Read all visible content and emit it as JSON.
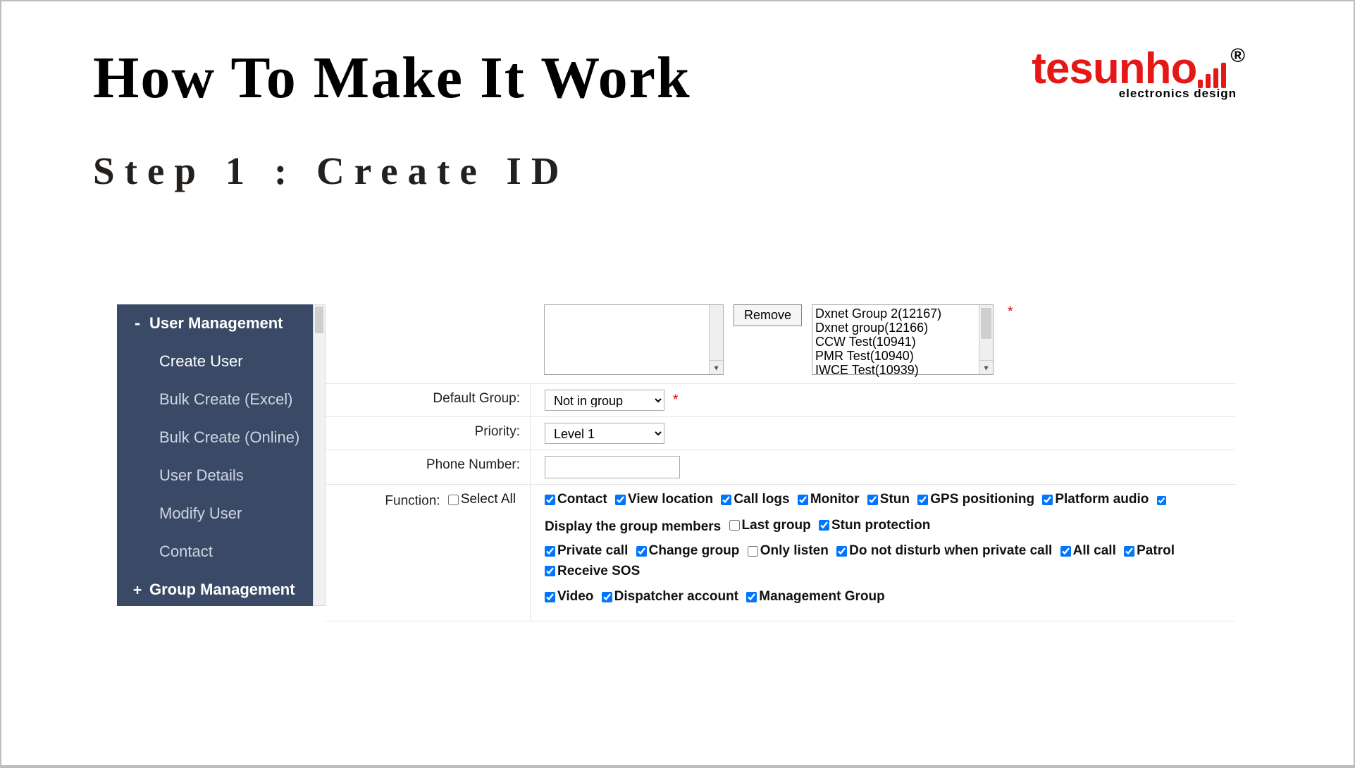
{
  "title": "How To Make It Work",
  "step": "Step 1 : Create ID",
  "logo": {
    "text": "tesunho",
    "sub": "electronics design",
    "reg": "®"
  },
  "sidebar": {
    "sections": [
      {
        "label": "User Management",
        "expanded": true,
        "toggle": "-",
        "items": [
          "Create User",
          "Bulk Create (Excel)",
          "Bulk Create (Online)",
          "User Details",
          "Modify User",
          "Contact"
        ]
      },
      {
        "label": "Group Management",
        "expanded": false,
        "toggle": "+"
      }
    ]
  },
  "form": {
    "remove_btn": "Remove",
    "group_list": [
      "Dxnet Group 2(12167)",
      "Dxnet group(12166)",
      "CCW Test(10941)",
      "PMR Test(10940)",
      "IWCE Test(10939)"
    ],
    "default_group": {
      "label": "Default Group:",
      "value": "Not in group"
    },
    "priority": {
      "label": "Priority:",
      "value": "Level 1"
    },
    "phone": {
      "label": "Phone Number:",
      "value": ""
    },
    "function_label": "Function:",
    "select_all": "Select All",
    "functions": [
      {
        "name": "Contact",
        "checked": true
      },
      {
        "name": "View location",
        "checked": true
      },
      {
        "name": "Call logs",
        "checked": true
      },
      {
        "name": "Monitor",
        "checked": true
      },
      {
        "name": "Stun",
        "checked": true
      },
      {
        "name": "GPS positioning",
        "checked": true
      },
      {
        "name": "Platform audio",
        "checked": true
      },
      {
        "name": "Display the group members",
        "checked": true,
        "trailing": true
      },
      {
        "name": "Last group",
        "checked": false
      },
      {
        "name": "Stun protection",
        "checked": true
      },
      {
        "name": "Private call",
        "checked": true
      },
      {
        "name": "Change group",
        "checked": true
      },
      {
        "name": "Only listen",
        "checked": false
      },
      {
        "name": "Do not disturb when private call",
        "checked": true
      },
      {
        "name": "All call",
        "checked": true
      },
      {
        "name": "Patrol",
        "checked": true
      },
      {
        "name": "Receive SOS",
        "checked": true
      },
      {
        "name": "Video",
        "checked": true
      },
      {
        "name": "Dispatcher account",
        "checked": true
      },
      {
        "name": "Management Group",
        "checked": true
      }
    ]
  }
}
